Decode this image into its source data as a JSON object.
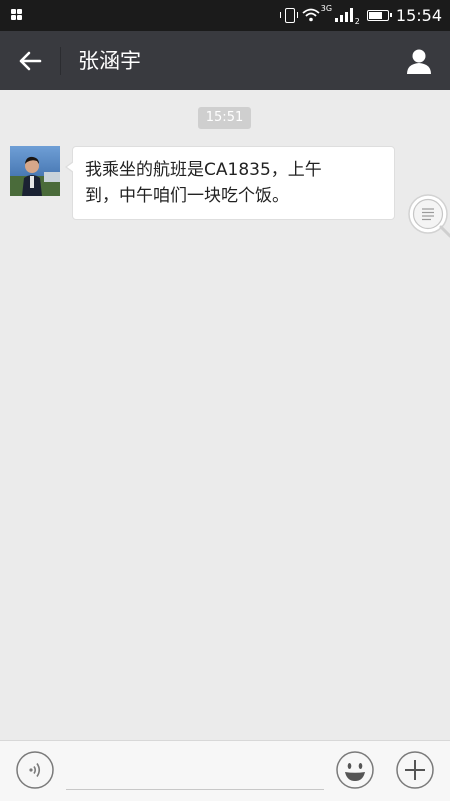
{
  "status_bar": {
    "network": "3G",
    "sim": "2",
    "time": "15:54",
    "battery_level": 0.65,
    "icons": [
      "apps-icon",
      "vibrate-icon",
      "wifi-icon",
      "signal-icon",
      "battery-icon"
    ]
  },
  "header": {
    "title": "张涵宇",
    "back_icon": "back-arrow-icon",
    "profile_icon": "person-icon",
    "background": "#393a3f"
  },
  "chat": {
    "timestamp": "15:51",
    "messages": [
      {
        "sender": "张涵宇",
        "direction": "incoming",
        "text_line1": "我乘坐的航班是CA1835，上午",
        "text_line2": "到，中午咱们一块吃个饭。"
      }
    ],
    "zoom_icon": "magnifier-text-icon"
  },
  "input_bar": {
    "voice_icon": "voice-icon",
    "emoji_icon": "emoji-icon",
    "plus_icon": "plus-icon",
    "placeholder": ""
  },
  "colors": {
    "chat_background": "#ebebeb",
    "status_bar": "#1b1b1b",
    "bubble": "#ffffff"
  }
}
